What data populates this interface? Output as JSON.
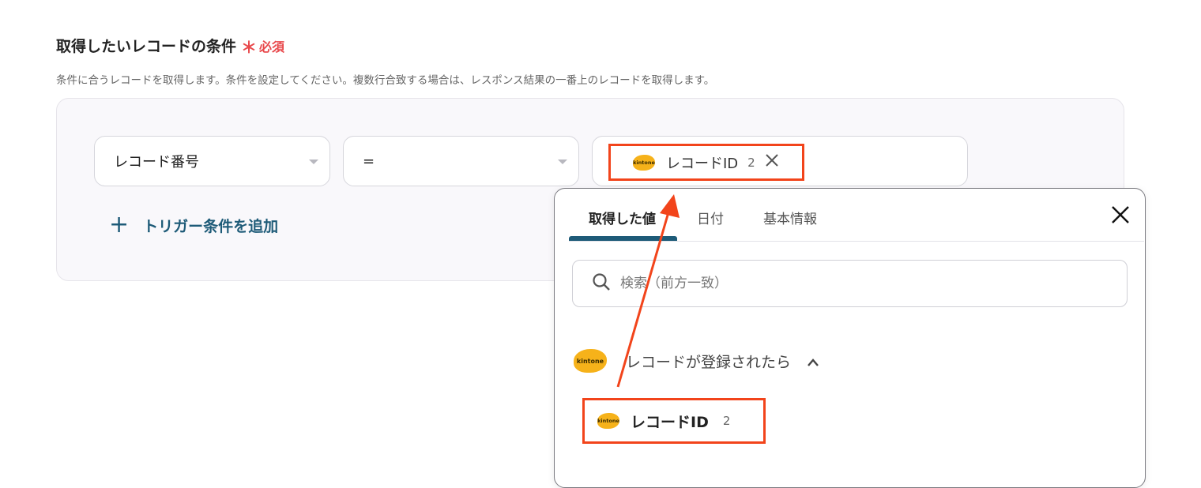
{
  "section": {
    "title": "取得したいレコードの条件",
    "required_label": "必須",
    "required_mark": "＊",
    "description": "条件に合うレコードを取得します。条件を設定してください。複数行合致する場合は、レスポンス結果の一番上のレコードを取得します。"
  },
  "condition": {
    "field": "レコード番号",
    "operator": "=",
    "value_token": {
      "icon": "kintone-logo",
      "icon_text": "kintone",
      "label": "レコードID",
      "count": "2",
      "remove_icon": "close-icon"
    }
  },
  "add_condition": {
    "plus": "+",
    "label": "トリガー条件を追加"
  },
  "popup": {
    "tabs": [
      {
        "label": "取得した値",
        "active": true
      },
      {
        "label": "日付",
        "active": false
      },
      {
        "label": "基本情報",
        "active": false
      }
    ],
    "close_icon": "close-icon",
    "search": {
      "placeholder": "検索（前方一致）",
      "icon": "search-icon"
    },
    "group": {
      "icon_text": "kintone",
      "label": "レコードが登録されたら",
      "expanded": true
    },
    "items": [
      {
        "icon_text": "kintone",
        "label": "レコードID",
        "count": "2"
      }
    ]
  },
  "colors": {
    "accent": "#1e5b78",
    "highlight": "#f2441b",
    "required": "#e8484b",
    "kintone": "#f6b21a"
  }
}
